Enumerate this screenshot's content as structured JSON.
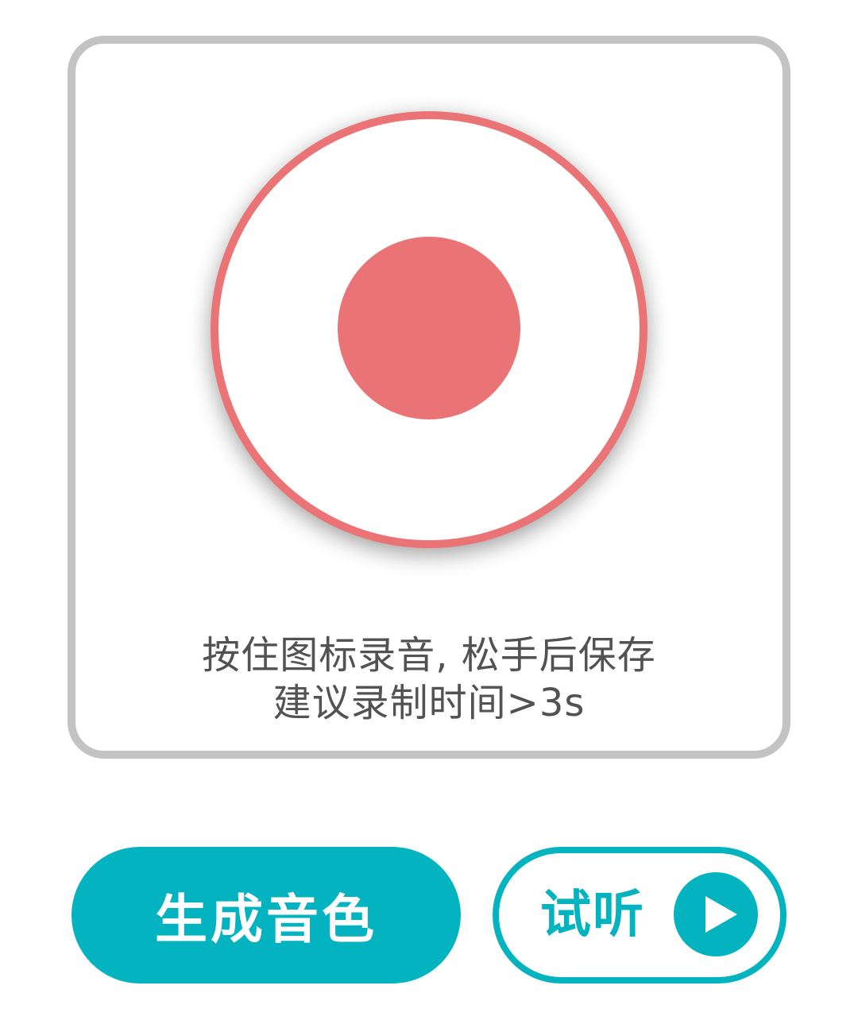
{
  "recorder": {
    "hint_line1": "按住图标录音, 松手后保存",
    "hint_line2": "建议录制时间>3s",
    "record_icon": "record-icon"
  },
  "actions": {
    "generate_label": "生成音色",
    "listen_label": "试听",
    "play_icon": "play-icon"
  },
  "colors": {
    "accent": "#03b4c0",
    "record": "#ea7475",
    "card_border": "#c3c3c3",
    "hint_text": "#525252"
  }
}
